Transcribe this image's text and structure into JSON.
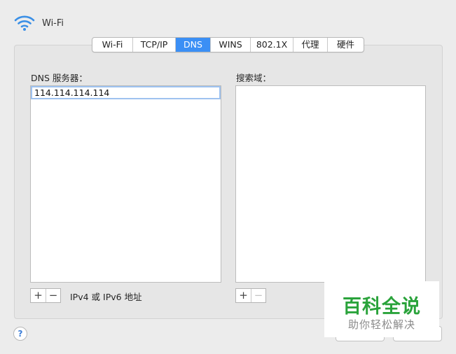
{
  "header": {
    "title": "Wi-Fi",
    "icon": "wifi-icon"
  },
  "tabs": [
    {
      "label": "Wi-Fi",
      "active": false
    },
    {
      "label": "TCP/IP",
      "active": false
    },
    {
      "label": "DNS",
      "active": true
    },
    {
      "label": "WINS",
      "active": false
    },
    {
      "label": "802.1X",
      "active": false
    },
    {
      "label": "代理",
      "active": false
    },
    {
      "label": "硬件",
      "active": false
    }
  ],
  "dns": {
    "label": "DNS 服务器：",
    "servers": [
      "114.114.114.114"
    ],
    "add": "+",
    "remove": "−",
    "hint": "IPv4 或 IPv6 地址"
  },
  "search": {
    "label": "搜索域：",
    "add": "+",
    "remove": "−"
  },
  "help": {
    "label": "?"
  },
  "watermark": {
    "title": "百科全说",
    "subtitle": "助你轻松解决"
  },
  "colors": {
    "accent": "#3b8ff5",
    "selection_border": "#9ec2f0",
    "watermark_green": "#2aa33b"
  }
}
